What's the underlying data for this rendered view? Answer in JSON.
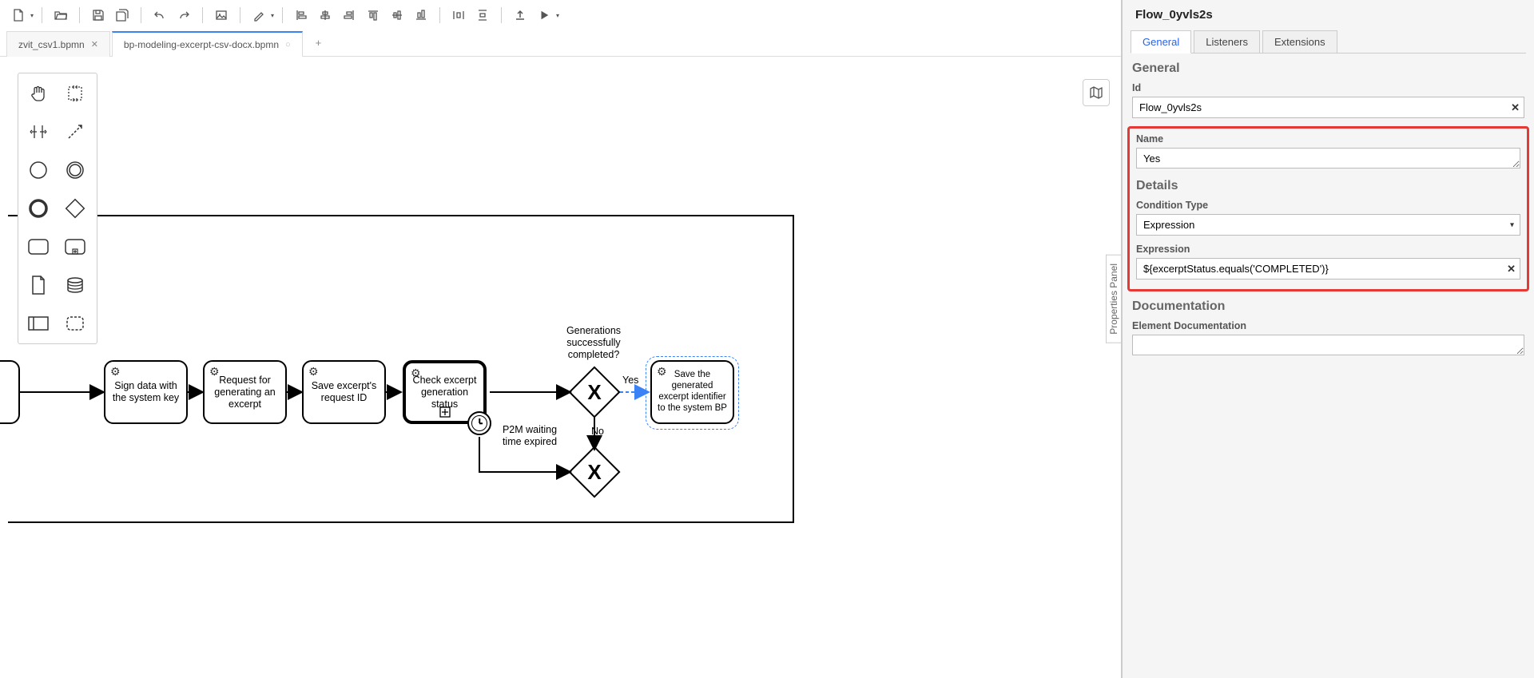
{
  "tabs": {
    "items": [
      {
        "label": "zvit_csv1.bpmn",
        "active": false
      },
      {
        "label": "bp-modeling-excerpt-csv-docx.bpmn",
        "active": true
      }
    ]
  },
  "properties_panel_label": "Properties Panel",
  "panel": {
    "title": "Flow_0yvls2s",
    "tabs": {
      "general": "General",
      "listeners": "Listeners",
      "extensions": "Extensions"
    },
    "sections": {
      "general": "General",
      "details": "Details",
      "documentation": "Documentation"
    },
    "fields": {
      "id_label": "Id",
      "id_value": "Flow_0yvls2s",
      "name_label": "Name",
      "name_value": "Yes",
      "condition_type_label": "Condition Type",
      "condition_type_value": "Expression",
      "expression_label": "Expression",
      "expression_value": "${excerptStatus.equals('COMPLETED')}",
      "doc_label": "Element Documentation",
      "doc_value": ""
    }
  },
  "diagram": {
    "task_sign": "Sign data with the system key",
    "task_request": "Request for generating an excerpt",
    "task_save_req": "Save excerpt's request ID",
    "task_check": "Check excerpt generation status",
    "task_save_gen": "Save the generated excerpt identifier to the system BP",
    "label_gen_complete": "Generations successfully completed?",
    "label_yes": "Yes",
    "label_no": "No",
    "label_timer": "P2M waiting time expired"
  }
}
